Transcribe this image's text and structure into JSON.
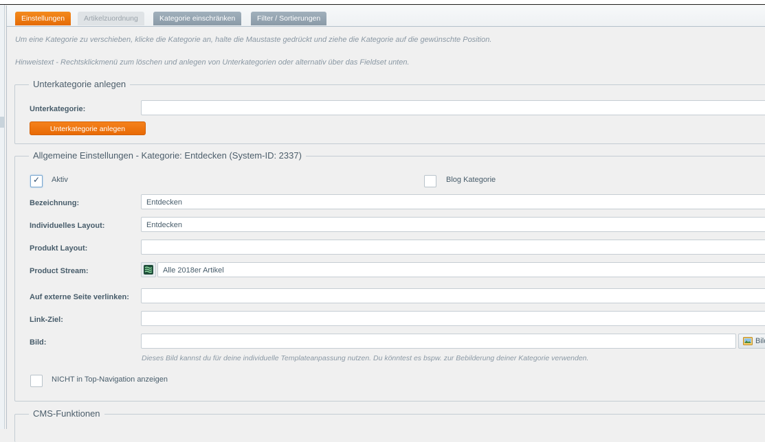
{
  "tabs": [
    {
      "label": "Einstellungen"
    },
    {
      "label": "Artikelzuordnung"
    },
    {
      "label": "Kategorie einschränken"
    },
    {
      "label": "Filter / Sortierungen"
    }
  ],
  "hints": {
    "move": "Um eine Kategorie zu verschieben, klicke die Kategorie an, halte die Maustaste gedrückt und ziehe die Kategorie auf die gewünschte Position.",
    "context": "Hinweistext - Rechtsklickmenü zum löschen und anlegen von Unterkategorien oder alternativ über das Fieldset unten."
  },
  "subcategory": {
    "legend": "Unterkategorie anlegen",
    "label": "Unterkategorie:",
    "value": "",
    "button": "Unterkategorie anlegen"
  },
  "general": {
    "legend": "Allgemeine Einstellungen - Kategorie: Entdecken (System-ID: 2337)",
    "aktiv_label": "Aktiv",
    "aktiv_checked": true,
    "blog_label": "Blog Kategorie",
    "blog_checked": false,
    "fields": {
      "bezeichnung": {
        "label": "Bezeichnung:",
        "value": "Entdecken"
      },
      "layout": {
        "label": "Individuelles Layout:",
        "value": "Entdecken"
      },
      "produkt_layout": {
        "label": "Produkt Layout:",
        "value": ""
      },
      "stream": {
        "label": "Product Stream:",
        "value": "Alle 2018er Artikel",
        "icon": "product-stream-icon"
      },
      "extern": {
        "label": "Auf externe Seite verlinken:",
        "value": ""
      },
      "linkziel": {
        "label": "Link-Ziel:",
        "value": ""
      },
      "bild": {
        "label": "Bild:",
        "value": "",
        "button": "Bild",
        "icon": "image-icon"
      }
    },
    "bild_hint": "Dieses Bild kannst du für deine individuelle Templateanpassung nutzen. Du könntest es bspw. zur Bebilderung deiner Kategorie verwenden.",
    "topnav_label": "NICHT in Top-Navigation anzeigen",
    "topnav_checked": false
  },
  "cms": {
    "legend": "CMS-Funktionen"
  },
  "colors": {
    "accent": "#e96d07",
    "tab_inactive": "#8e9eab",
    "text": "#475c6a",
    "hint": "#8a98a4"
  }
}
